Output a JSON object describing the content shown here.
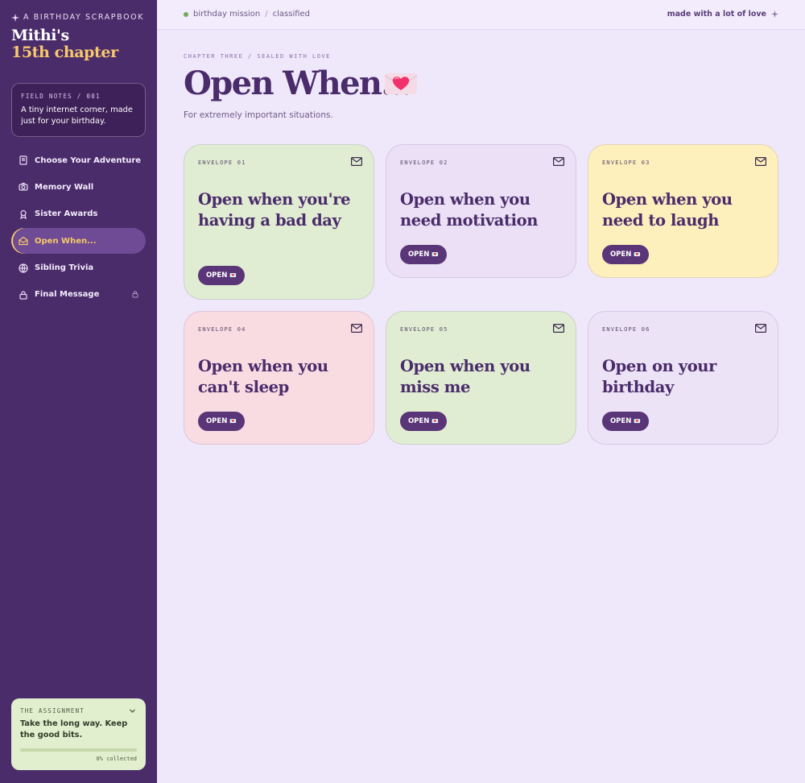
{
  "sidebar": {
    "kicker": "A BIRTHDAY SCRAPBOOK",
    "title_line1": "Mithi's",
    "title_line2": "15th chapter",
    "field_notes": {
      "kicker": "FIELD NOTES / 001",
      "text": "A tiny internet corner, made just for your birthday."
    },
    "nav": [
      {
        "label": "Choose Your Adventure",
        "icon": "book-icon"
      },
      {
        "label": "Memory Wall",
        "icon": "camera-icon"
      },
      {
        "label": "Sister Awards",
        "icon": "award-icon"
      },
      {
        "label": "Open When...",
        "icon": "envelope-open-icon",
        "active": true
      },
      {
        "label": "Sibling Trivia",
        "icon": "globe-icon"
      },
      {
        "label": "Final Message",
        "icon": "lock-icon",
        "locked": true
      }
    ],
    "assignment": {
      "kicker": "THE ASSIGNMENT",
      "text": "Take the long way. Keep the good bits.",
      "progress_percent": 0,
      "count_label": "0% collected"
    }
  },
  "topbar": {
    "crumb_1": "birthday mission",
    "crumb_sep": "/",
    "crumb_2": "classified",
    "made_with": "made with a lot of love",
    "status_color": "#77a85a"
  },
  "main": {
    "kicker": "CHAPTER THREE / SEALED WITH LOVE",
    "title": "Open When...",
    "title_icon": "heart-envelope-icon",
    "subtitle": "For extremely important situations.",
    "open_label": "OPEN",
    "cards": [
      {
        "envelope": "ENVELOPE 01",
        "title": "Open when you're having a bad day",
        "color": "#e0edd3"
      },
      {
        "envelope": "ENVELOPE 02",
        "title": "Open when you need motivation",
        "color": "#ebe0f6"
      },
      {
        "envelope": "ENVELOPE 03",
        "title": "Open when you need to laugh",
        "color": "#fdf0bd"
      },
      {
        "envelope": "ENVELOPE 04",
        "title": "Open when you can't sleep",
        "color": "#f9dce2"
      },
      {
        "envelope": "ENVELOPE 05",
        "title": "Open when you miss me",
        "color": "#e0edd3"
      },
      {
        "envelope": "ENVELOPE 06",
        "title": "Open on your birthday",
        "color": "#ece3f7"
      }
    ]
  },
  "colors": {
    "sidebar_bg": "#4b2c6b",
    "accent_gold": "#f7c96a",
    "button_purple": "#5a3577",
    "page_bg": "#efe8fb"
  }
}
